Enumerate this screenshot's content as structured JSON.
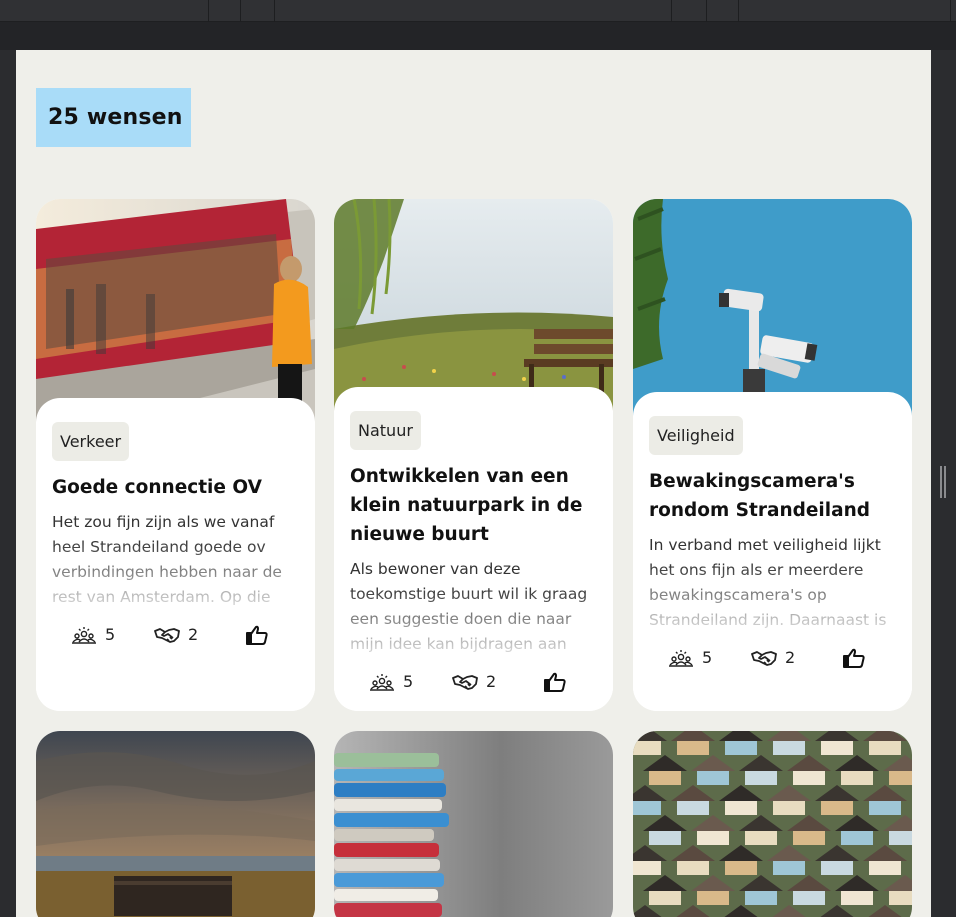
{
  "header": {
    "count_title": "25 wensen"
  },
  "cards": [
    {
      "category": "Verkeer",
      "title": "Goede connectie OV",
      "description": "Het zou fijn zijn als we vanaf heel Strandeiland goede ov verbindingen hebben naar de rest van Amsterdam. Op die",
      "supporters": "5",
      "partners": "2",
      "image": "train-platform-photo"
    },
    {
      "category": "Natuur",
      "title": "Ontwikkelen van een klein natuurpark in de nieuwe buurt",
      "description": "Als bewoner van deze toekomstige buurt wil ik graag een suggestie doen die naar mijn idee kan bijdragen aan",
      "supporters": "5",
      "partners": "2",
      "image": "meadow-bench-photo"
    },
    {
      "category": "Veiligheid",
      "title": "Bewakingscamera's rondom Strandeiland",
      "description": "In verband met veiligheid lijkt het ons fijn als er meerdere bewakingscamera's op Strandeiland zijn. Daarnaast is",
      "supporters": "5",
      "partners": "2",
      "image": "security-camera-photo"
    },
    {
      "image": "bench-sunset-photo"
    },
    {
      "image": "book-stack-photo"
    },
    {
      "image": "houses-aerial-photo"
    }
  ],
  "icons": {
    "supporters": "community-icon",
    "partners": "handshake-icon",
    "like": "thumbs-up-icon"
  },
  "colors": {
    "title_bg": "#a9dcf8",
    "page_bg": "#efefea",
    "chip_bg": "#ecece6"
  }
}
